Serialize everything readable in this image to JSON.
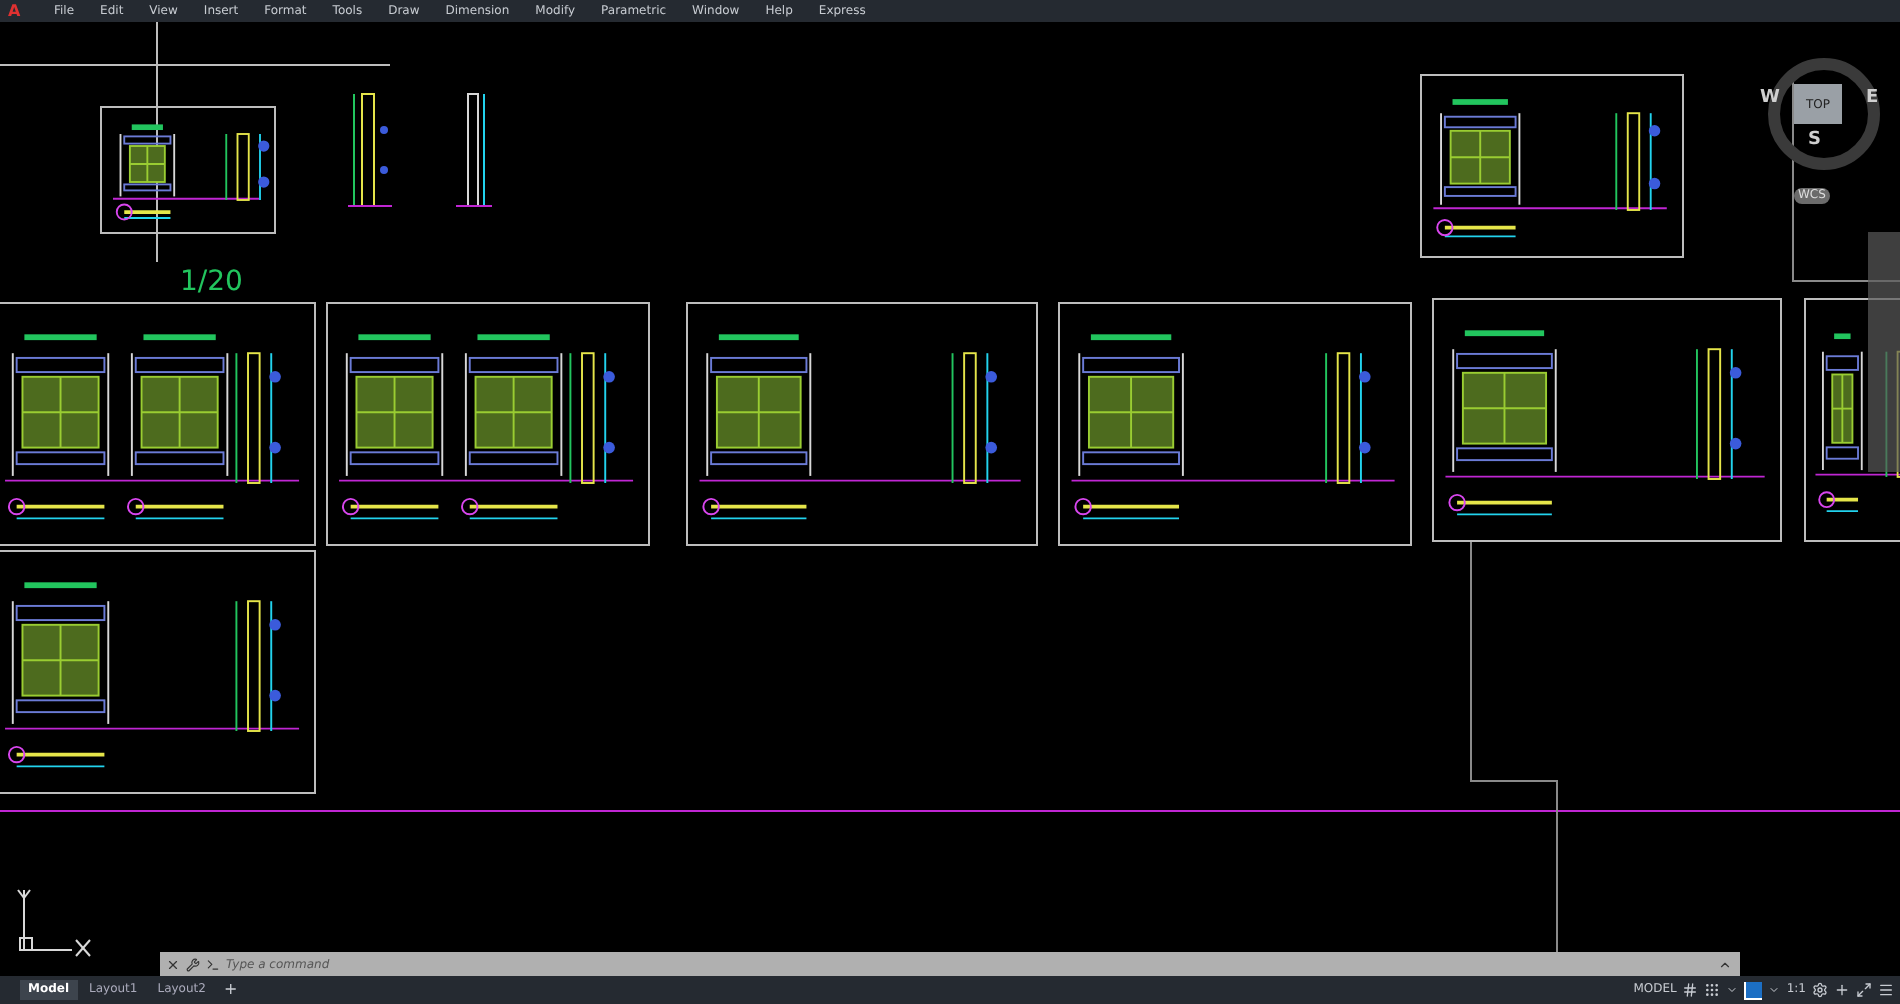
{
  "app_icon": {
    "label": "A"
  },
  "menu": [
    "File",
    "Edit",
    "View",
    "Insert",
    "Format",
    "Tools",
    "Draw",
    "Dimension",
    "Modify",
    "Parametric",
    "Window",
    "Help",
    "Express"
  ],
  "drawing": {
    "scale_label": "1/20"
  },
  "view_cube": {
    "face": "TOP",
    "west": "W",
    "east": "E",
    "south": "S",
    "ucs": "WCS"
  },
  "command_line": {
    "placeholder": "Type a command"
  },
  "layout_tabs": [
    {
      "label": "Model",
      "selected": true
    },
    {
      "label": "Layout1",
      "selected": false
    },
    {
      "label": "Layout2",
      "selected": false
    }
  ],
  "add_tab": "+",
  "status_bar": {
    "space": "MODEL",
    "scale": "1:1"
  }
}
